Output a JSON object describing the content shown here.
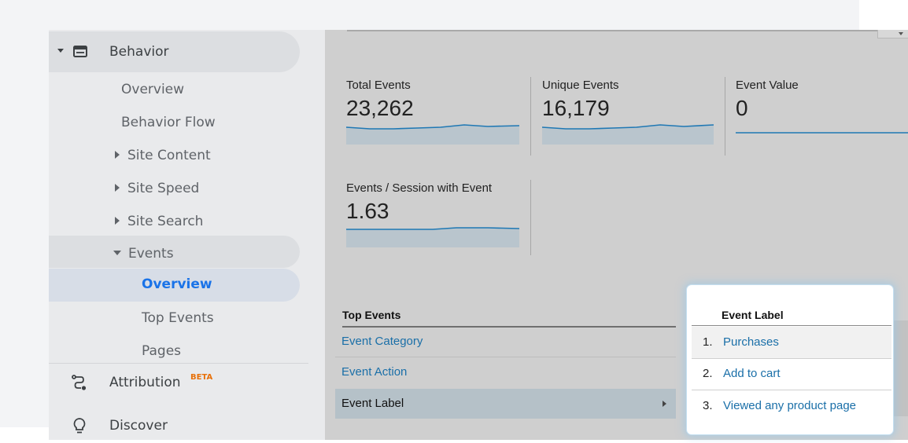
{
  "sidebar": {
    "behavior_label": "Behavior",
    "items": [
      {
        "label": "Overview"
      },
      {
        "label": "Behavior Flow"
      },
      {
        "label": "Site Content"
      },
      {
        "label": "Site Speed"
      },
      {
        "label": "Site Search"
      },
      {
        "label": "Events"
      }
    ],
    "events_sub": [
      {
        "label": "Overview"
      },
      {
        "label": "Top Events"
      },
      {
        "label": "Pages"
      }
    ],
    "attribution_label": "Attribution",
    "attribution_badge": "BETA",
    "discover_label": "Discover"
  },
  "metrics": [
    {
      "label": "Total Events",
      "value": "23,262"
    },
    {
      "label": "Unique Events",
      "value": "16,179"
    },
    {
      "label": "Event Value",
      "value": "0"
    },
    {
      "label": "Events / Session with Event",
      "value": "1.63"
    }
  ],
  "top_events": {
    "header": "Top Events",
    "rows": [
      {
        "label": "Event Category"
      },
      {
        "label": "Event Action"
      },
      {
        "label": "Event Label"
      }
    ]
  },
  "popup": {
    "title": "Event Label",
    "rows": [
      {
        "num": "1.",
        "label": "Purchases"
      },
      {
        "num": "2.",
        "label": "Add to cart"
      },
      {
        "num": "3.",
        "label": "Viewed any product page"
      }
    ]
  },
  "colors": {
    "link": "#1a6fa8",
    "active_nav": "#1a73e8",
    "beta_badge": "#e8710a",
    "sparkline": "#1f78b4"
  }
}
